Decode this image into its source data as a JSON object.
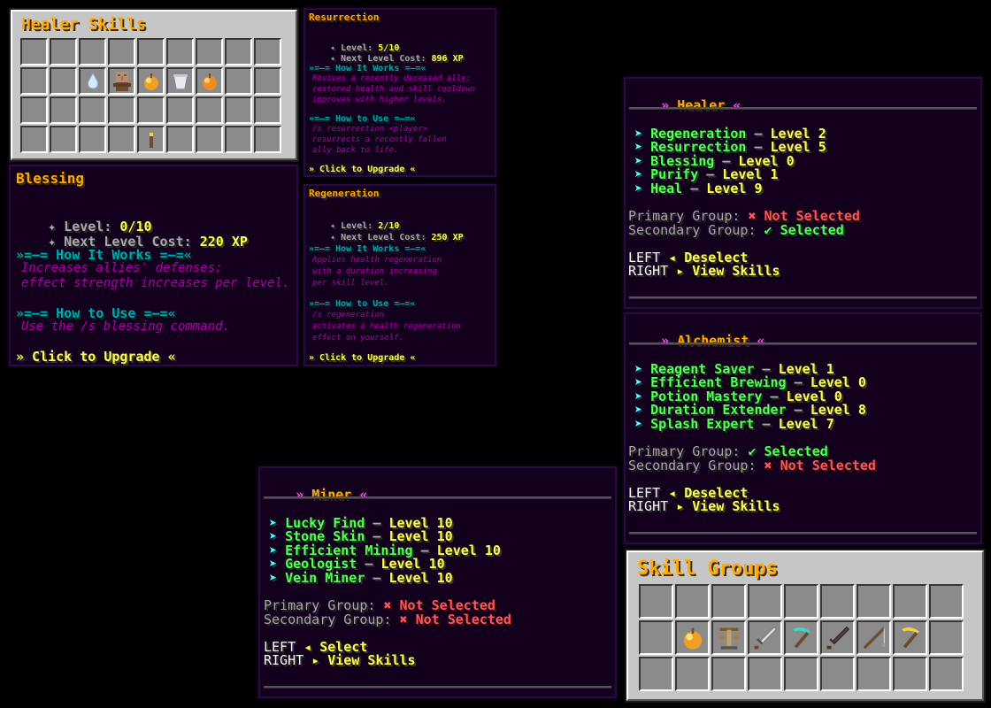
{
  "healer_chest": {
    "title": "Healer Skills"
  },
  "blessing": {
    "title": "Blessing",
    "level_label": "✦ Level: ",
    "level_value": "0/10",
    "cost_label": "✦ Next Level Cost: ",
    "cost_value": "220 XP",
    "how_works_header": "»=—= How It Works =—=«",
    "how_works_lines": [
      "Increases allies' defenses;",
      "effect strength increases per level."
    ],
    "how_use_header": "»=—= How to Use =—=«",
    "how_use_lines": [
      "Use the /s blessing command."
    ],
    "upgrade": "» Click to Upgrade «"
  },
  "resurrection": {
    "title": "Resurrection",
    "level_label": "✦ Level: ",
    "level_value": "5/10",
    "cost_label": "✦ Next Level Cost: ",
    "cost_value": "896 XP",
    "how_works_header": "»=—= How It Works =—=«",
    "how_works_lines": [
      "Revives a recently deceased ally;",
      "restored health and skill cooldown",
      "improves with higher levels."
    ],
    "how_use_header": "»=—= How to Use =—=«",
    "how_use_lines": [
      "/s resurrection <player>",
      "resurrects a recently fallen",
      "ally back to life."
    ],
    "upgrade": "» Click to Upgrade «"
  },
  "regeneration": {
    "title": "Regeneration",
    "level_label": "✦ Level: ",
    "level_value": "2/10",
    "cost_label": "✦ Next Level Cost: ",
    "cost_value": "250 XP",
    "how_works_header": "»=—= How It Works =—=«",
    "how_works_lines": [
      "Applies health regeneration",
      "with a duration increasing",
      "per skill level."
    ],
    "how_use_header": "»=—= How to Use =—=«",
    "how_use_lines": [
      "/s regeneration",
      "activates a health regeneration",
      "effect on yourself."
    ],
    "upgrade": "» Click to Upgrade «"
  },
  "healer": {
    "title_prefix": "» ",
    "title": "Healer",
    "title_suffix": " «",
    "skills": [
      {
        "name": "Regeneration",
        "level": "Level 2"
      },
      {
        "name": "Resurrection",
        "level": "Level 5"
      },
      {
        "name": "Blessing",
        "level": "Level 0"
      },
      {
        "name": "Purify",
        "level": "Level 1"
      },
      {
        "name": "Heal",
        "level": "Level 9"
      }
    ],
    "primary_label": "Primary Group: ",
    "primary_value": "✖ Not Selected",
    "secondary_label": "Secondary Group: ",
    "secondary_value": "✔ Selected",
    "left_label": "LEFT ",
    "left_action": "◂ Deselect",
    "right_label": "RIGHT ",
    "right_action": "▸ View Skills"
  },
  "alchemist": {
    "title_prefix": "» ",
    "title": "Alchemist",
    "title_suffix": " «",
    "skills": [
      {
        "name": "Reagent Saver",
        "level": "Level 1"
      },
      {
        "name": "Efficient Brewing",
        "level": "Level 0"
      },
      {
        "name": "Potion Mastery",
        "level": "Level 0"
      },
      {
        "name": "Duration Extender",
        "level": "Level 8"
      },
      {
        "name": "Splash Expert",
        "level": "Level 7"
      }
    ],
    "primary_label": "Primary Group: ",
    "primary_value": "✔ Selected",
    "secondary_label": "Secondary Group: ",
    "secondary_value": "✖ Not Selected",
    "left_label": "LEFT ",
    "left_action": "◂ Deselect",
    "right_label": "RIGHT ",
    "right_action": "▸ View Skills"
  },
  "miner": {
    "title_prefix": "» ",
    "title": "Miner",
    "title_suffix": " «",
    "skills": [
      {
        "name": "Lucky Find",
        "level": "Level 10"
      },
      {
        "name": "Stone Skin",
        "level": "Level 10"
      },
      {
        "name": "Efficient Mining",
        "level": "Level 10"
      },
      {
        "name": "Geologist",
        "level": "Level 10"
      },
      {
        "name": "Vein Miner",
        "level": "Level 10"
      }
    ],
    "primary_label": "Primary Group: ",
    "primary_value": "✖ Not Selected",
    "secondary_label": "Secondary Group: ",
    "secondary_value": "✖ Not Selected",
    "left_label": "LEFT ",
    "left_action": "◂ Select",
    "right_label": "RIGHT ",
    "right_action": "▸ View Skills"
  },
  "skill_groups": {
    "title": "Skill Groups"
  },
  "colors": {
    "gold": "#ffaa00",
    "yellow": "#ffff55",
    "aqua": "#00aaaa",
    "purple": "#aa00aa",
    "green": "#55ff55",
    "red": "#ff5555",
    "cyan": "#55ffff",
    "pink": "#ff55ff",
    "tooltip_bg": "#12001c",
    "slot_bg": "#8b8b8b",
    "chest_bg": "#c6c6c6"
  },
  "icons": {
    "healer_chest_items": [
      "water-drop-icon",
      "villager-head-icon",
      "golden-apple-icon",
      "bucket-icon",
      "enchanted-apple-icon",
      "torch-icon"
    ],
    "skill_group_items": [
      "golden-apple-icon",
      "brewing-stand-icon",
      "iron-sword-icon",
      "diamond-pickaxe-icon",
      "netherite-sword-icon",
      "fishing-rod-icon",
      "golden-pickaxe-icon"
    ]
  }
}
